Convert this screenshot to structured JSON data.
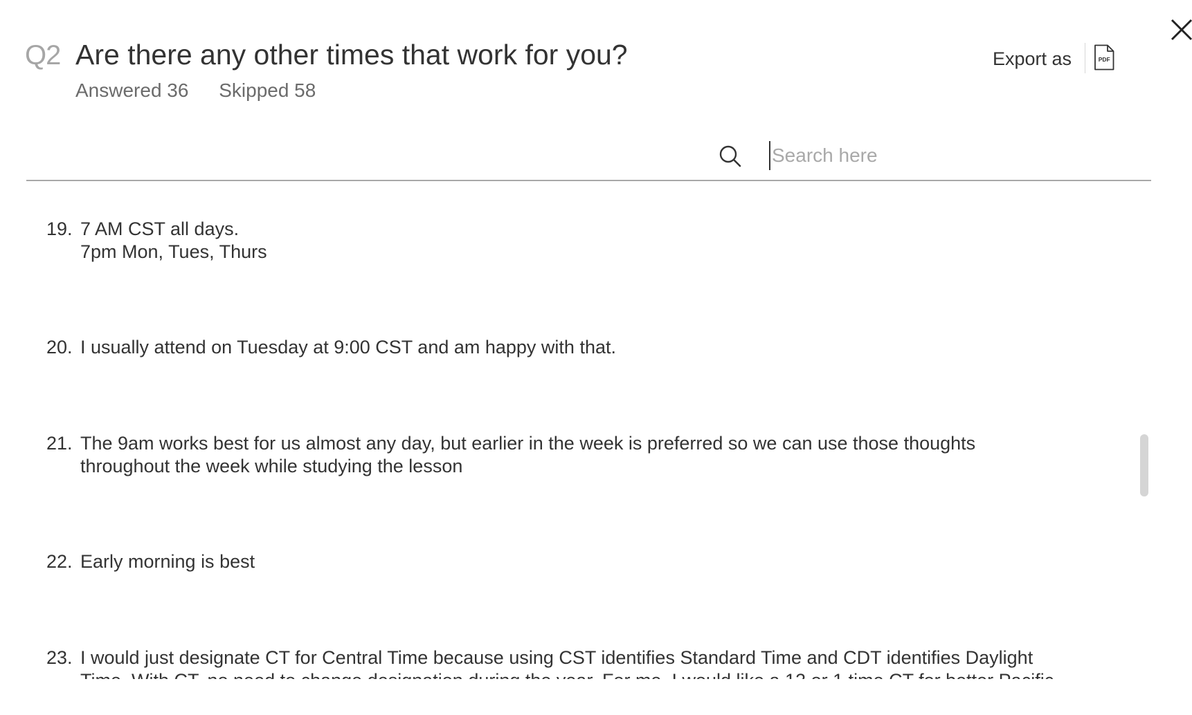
{
  "question": {
    "number": "Q2",
    "title": "Are there any other times that work for you?",
    "answered_label": "Answered 36",
    "skipped_label": "Skipped 58"
  },
  "export": {
    "label": "Export as",
    "format_icon": "pdf-file-icon",
    "pdf_text": "PDF"
  },
  "close_icon": "close-icon",
  "search": {
    "icon": "search-icon",
    "placeholder": "Search here",
    "value": ""
  },
  "responses": [
    {
      "num": "19.",
      "text": "7 AM CST all days.\n7pm Mon, Tues, Thurs"
    },
    {
      "num": "20.",
      "text": "I usually attend on Tuesday at 9:00 CST and am happy with that."
    },
    {
      "num": "21.",
      "text": "The 9am works best for us almost any day, but earlier in the week is preferred so we can use those thoughts\nthroughout the week while studying the lesson"
    },
    {
      "num": "22.",
      "text": "Early morning is best"
    },
    {
      "num": "23.",
      "text": "I would just designate CT for Central Time because using CST identifies Standard Time and CDT identifies Daylight\nTime. With CT, no need to change designation during the year. For me, I would like a 12 or 1 time CT for better Pacific"
    }
  ],
  "scrollbar": {
    "position_fraction": 0.52
  }
}
